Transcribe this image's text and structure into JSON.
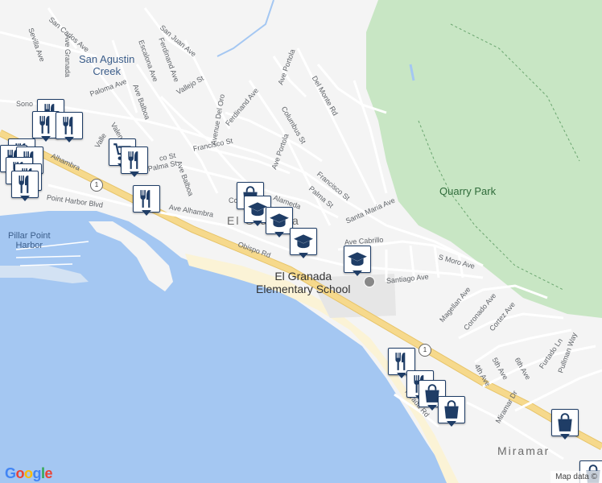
{
  "labels": {
    "san_agustin_creek": "San Agustin\nCreek",
    "quarry_park": "Quarry Park",
    "pillar_point_harbor": "Pillar Point\nHarbor",
    "el_granada_town": "El Granada",
    "el_granada_school": "El Granada\nElementary School",
    "miramar": "Miramar",
    "point_harbor_blvd": "Point Harbor Blvd",
    "alhambra_w": "Alhambra",
    "ave_alhambra": "Ave Alhambra",
    "obispo_rd": "Obispo Rd",
    "santa_maria_ave": "Santa Maria Ave",
    "ave_cabrillo": "Ave Cabrillo",
    "santiago_ave": "Santiago Ave",
    "s_moro_ave": "S Moro Ave",
    "francisco_st_e": "Francisco St",
    "francisco_st_w": "Francisco St",
    "palma_st_e": "Palma St",
    "palma_st_w": "Palma St",
    "columbus_st": "Columbus St",
    "del_monte_rd": "Del Monte Rd",
    "ave_portola_n": "Ave Portola",
    "ave_portola_s": "Ave Portola",
    "ave_balboa_n": "Ave Balboa",
    "ave_balboa_s": "Ave Balboa",
    "avenue_del_oro": "Avenue Del Oro",
    "ferdinand_ave_n": "Ferdinand Ave",
    "ferdinand_ave_s": "Ferdinand Ave",
    "escalona_ave": "Escalona Ave",
    "san_juan_ave": "San Juan Ave",
    "san_carlos_ave": "San Carlos Ave",
    "sevilla_ave": "Sevilla Ave",
    "ave_granada": "Ave Granada",
    "paloma_ave": "Paloma Ave",
    "vallejo_st": "Vallejo St",
    "valencia_ave": "Valencia Ave",
    "ave_alameda": "Alameda",
    "magellan_ave": "Magellan Ave",
    "coronado_ave": "Coronado Ave",
    "cortez_ave": "Cortez Ave",
    "fourth_ave": "4th Ave",
    "fifth_ave": "5th Ave",
    "sixth_ave": "6th Ave",
    "furtado_ln": "Furtado Ln",
    "pullman_way": "Pullman Way",
    "mirada_rd": "Mirada Rd",
    "miramar_dr": "Miramar Dr",
    "sonoma": "Sono",
    "valle": "Valle",
    "co": "Co",
    "co2": "co St"
  },
  "highway_shield": "1",
  "footer": {
    "google": "Google",
    "map_data": "Map data ©"
  },
  "pins": [
    {
      "type": "restaurant"
    },
    {
      "type": "restaurant"
    },
    {
      "type": "restaurant"
    },
    {
      "type": "restaurant"
    },
    {
      "type": "restaurant"
    },
    {
      "type": "restaurant"
    },
    {
      "type": "restaurant"
    },
    {
      "type": "restaurant"
    },
    {
      "type": "restaurant"
    },
    {
      "type": "grocery"
    },
    {
      "type": "restaurant"
    },
    {
      "type": "restaurant"
    },
    {
      "type": "shopping"
    },
    {
      "type": "school"
    },
    {
      "type": "school"
    },
    {
      "type": "school"
    },
    {
      "type": "school"
    },
    {
      "type": "restaurant"
    },
    {
      "type": "restaurant"
    },
    {
      "type": "shopping"
    },
    {
      "type": "shopping"
    },
    {
      "type": "shopping"
    },
    {
      "type": "shopping"
    }
  ],
  "colors": {
    "water": "#a4c7f2",
    "park": "#c8e6c4",
    "highway": "#f6d98c",
    "pin_border": "#1f3d66",
    "pin_icon": "#1f3d66"
  }
}
